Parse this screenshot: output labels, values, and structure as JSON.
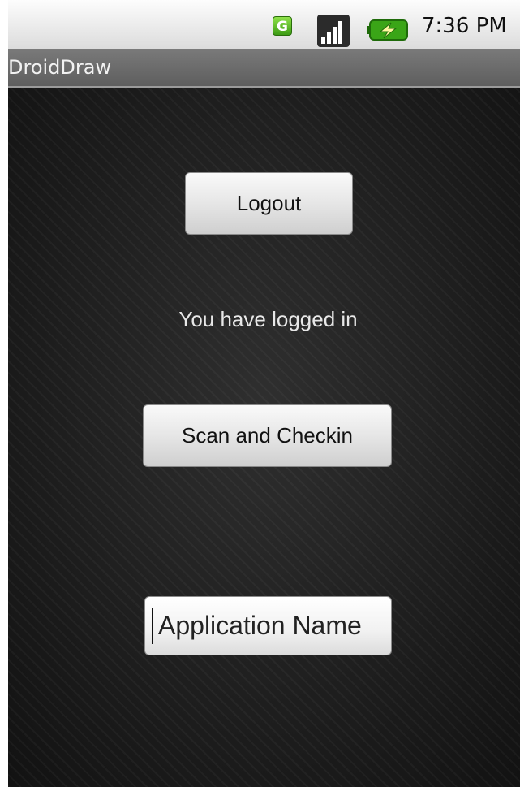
{
  "status_bar": {
    "network_badge": "G",
    "time": "7:36 PM",
    "icons": [
      "gprs-icon",
      "signal-icon",
      "battery-charging-icon"
    ]
  },
  "title_bar": {
    "title": "DroidDraw"
  },
  "main": {
    "logout_label": "Logout",
    "status_text": "You have logged in",
    "scan_label": "Scan and Checkin",
    "app_name_value": "Application Name"
  },
  "colors": {
    "status_bar": "#e8e8e8",
    "title_bar": "#6b6b6b",
    "background": "#1d1d1d",
    "button_face": "#e6e6e6",
    "signal_green": "#3c9b14"
  }
}
